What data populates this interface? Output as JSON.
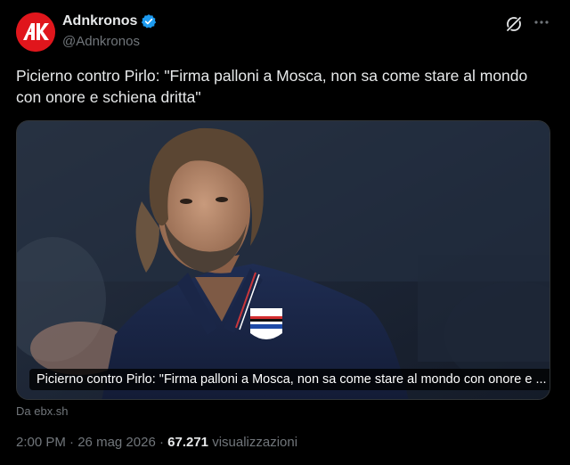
{
  "account": {
    "display_name": "Adnkronos",
    "handle": "@Adnkronos",
    "verified": true,
    "avatar_logo_text": "AK",
    "avatar_color": "#e0161c"
  },
  "tweet": {
    "text": "Picierno contro Pirlo: \"Firma palloni a Mosca, non sa come stare al mondo con onore e schiena dritta\""
  },
  "card": {
    "caption": "Picierno contro Pirlo: \"Firma palloni a Mosca, non sa come stare al mondo con onore e ...",
    "source": "Da ebx.sh"
  },
  "meta": {
    "time": "2:00 PM",
    "separator": "·",
    "date": "26 mag 2026",
    "views_count": "67.271",
    "views_label": "visualizzazioni"
  },
  "icons": {
    "verified": "verified-badge-icon",
    "grok": "grok-icon",
    "more": "more-dots-icon"
  },
  "colors": {
    "background": "#000000",
    "primary_text": "#e7e9ea",
    "secondary_text": "#71767b",
    "verified_blue": "#1d9bf0"
  }
}
